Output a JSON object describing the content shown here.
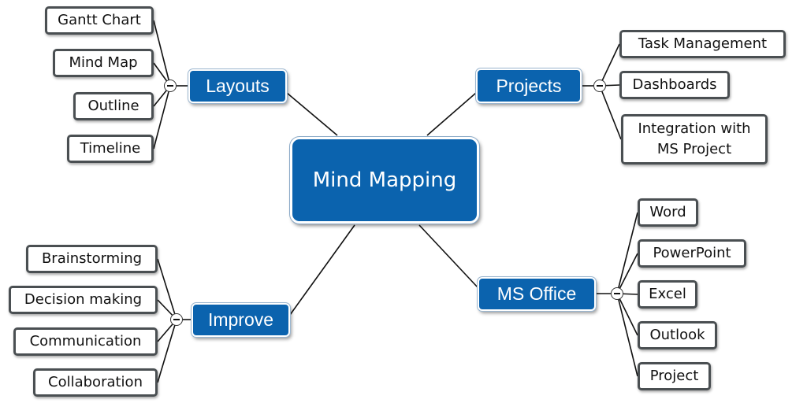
{
  "central": {
    "label": "Mind Mapping"
  },
  "colors": {
    "topic_fill": "#0b63ae",
    "leaf_border": "#4a4f52",
    "link": "#111111"
  },
  "branches": [
    {
      "id": "layouts",
      "label": "Layouts",
      "toggle_icon": "collapse-minus-icon",
      "children": [
        "Gantt Chart",
        "Mind Map",
        "Outline",
        "Timeline"
      ]
    },
    {
      "id": "projects",
      "label": "Projects",
      "toggle_icon": "collapse-minus-icon",
      "children": [
        "Task Management",
        "Dashboards",
        "Integration with\nMS Project"
      ]
    },
    {
      "id": "improve",
      "label": "Improve",
      "toggle_icon": "collapse-minus-icon",
      "children": [
        "Brainstorming",
        "Decision making",
        "Communication",
        "Collaboration"
      ]
    },
    {
      "id": "ms-office",
      "label": "MS Office",
      "toggle_icon": "collapse-minus-icon",
      "children": [
        "Word",
        "PowerPoint",
        "Excel",
        "Outlook",
        "Project"
      ]
    }
  ]
}
